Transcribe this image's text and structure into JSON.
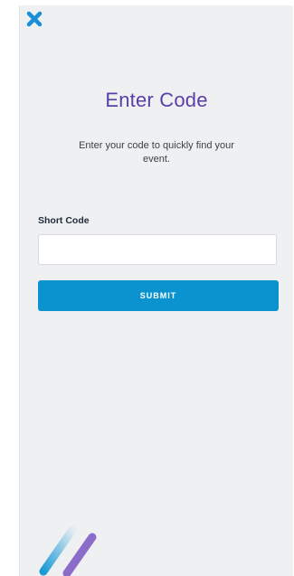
{
  "dialog": {
    "title": "Enter Code",
    "subtitle": "Enter your code to quickly find your event.",
    "close_icon": "close-icon"
  },
  "form": {
    "label": "Short Code",
    "input_value": "",
    "input_placeholder": "",
    "submit_label": "SUBMIT"
  },
  "brand": {
    "logo_icon": "brand-stripes-logo"
  },
  "colors": {
    "accent_blue": "#0b93cf",
    "title_purple": "#5b3fa8",
    "logo_purple": "#8c6cc9",
    "close_blue": "#1a8fd6",
    "panel_bg": "#eef0f2"
  }
}
